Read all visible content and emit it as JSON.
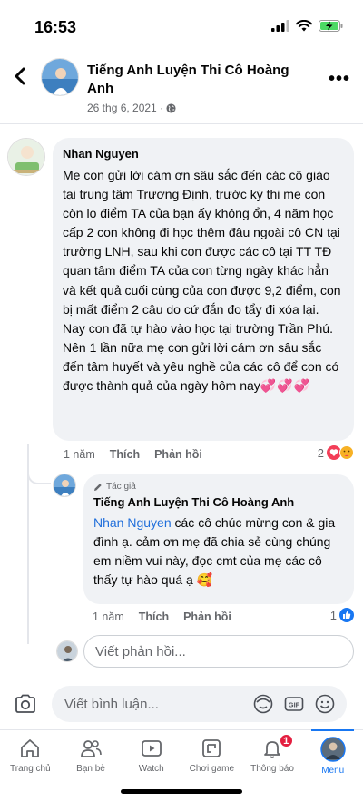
{
  "status_bar": {
    "time": "16:53"
  },
  "header": {
    "title": "Tiếng Anh Luyện Thi Cô Hoàng Anh",
    "date": "26 thg 6, 2021 ·"
  },
  "comment": {
    "author": "Nhan Nguyen",
    "text": "Mẹ con gửi lời cám ơn sâu sắc đến các cô giáo tại trung tâm Trương Định, trước kỳ thi mẹ con còn lo điểm TA của bạn ấy không ổn, 4 năm học cấp 2 con không đi học thêm đâu ngoài cô CN tại trường LNH, sau khi con được các cô tại TT TĐ quan tâm điểm TA của con từng ngày khác hẳn và kết quả cuối cùng của con được 9,2 điểm, con bị mất điểm 2 câu do cứ đắn đo tẩy đi xóa lại. Nay con đã tự hào vào học tại trường Trần Phú. Nên 1 lần nữa mẹ con gửi lời cám ơn sâu sắc đến tâm huyết và yêu nghề của các cô để con có được thành quả của ngày hôm nay",
    "emoji": "💞💞💞",
    "time": "1 năm",
    "like_label": "Thích",
    "reply_label": "Phản hồi",
    "reaction_count": "2"
  },
  "reply": {
    "badge": "Tác giả",
    "author": "Tiếng Anh Luyện Thi Cô Hoàng Anh",
    "mention": "Nhan Nguyen",
    "text": " các cô chúc mừng con & gia đình ạ. cảm ơn mẹ đã chia sẻ cùng chúng em niềm vui này, đọc cmt của mẹ các cô thấy tự hào quá ạ",
    "emoji": "🥰",
    "time": "1 năm",
    "like_label": "Thích",
    "reply_label": "Phản hồi",
    "reaction_count": "1"
  },
  "reply_input": {
    "placeholder": "Viết phản hồi..."
  },
  "comment_input": {
    "placeholder": "Viết bình luận..."
  },
  "tabs": [
    {
      "label": "Trang chủ",
      "icon": "home-icon"
    },
    {
      "label": "Bạn bè",
      "icon": "friends-icon"
    },
    {
      "label": "Watch",
      "icon": "watch-icon"
    },
    {
      "label": "Chơi game",
      "icon": "gaming-icon"
    },
    {
      "label": "Thông báo",
      "icon": "bell-icon",
      "badge": "1"
    },
    {
      "label": "Menu",
      "icon": "menu-avatar-icon"
    }
  ],
  "colors": {
    "accent": "#1877f2",
    "bubble": "#f0f2f5",
    "badge_red": "#e41e3f",
    "muted": "#65676b"
  }
}
